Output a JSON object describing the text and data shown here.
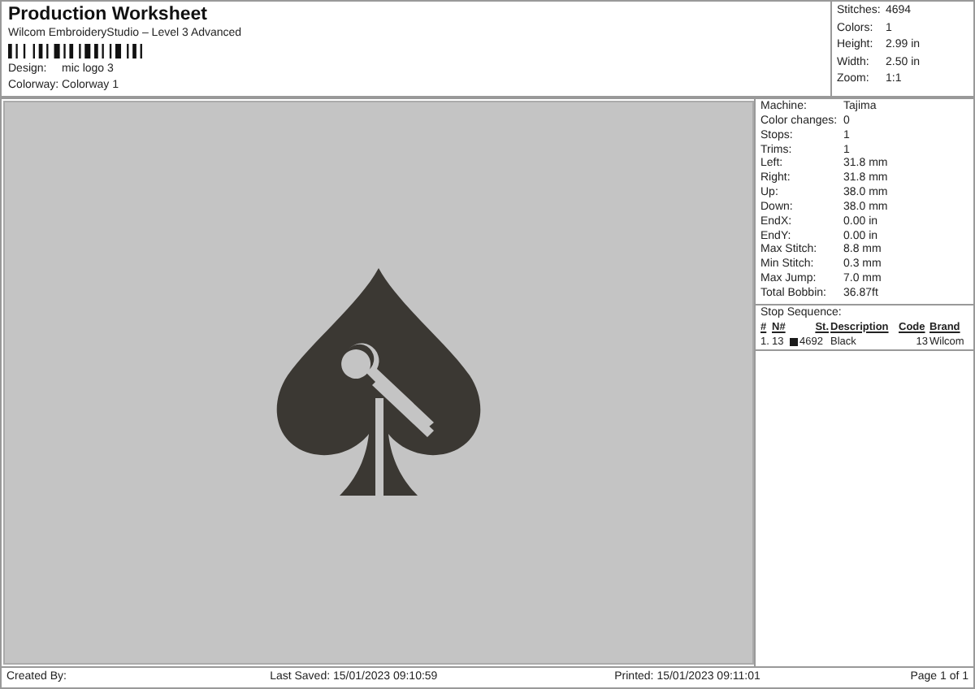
{
  "header": {
    "title": "Production Worksheet",
    "subtitle": "Wilcom EmbroideryStudio – Level 3 Advanced",
    "fields": [
      {
        "label": "Design:",
        "value": "mic logo 3"
      },
      {
        "label": "Colorway:",
        "value": "Colorway 1"
      }
    ]
  },
  "summary": [
    {
      "label": "Stitches:",
      "value": "4694"
    },
    {
      "label": "Colors:",
      "value": "1"
    },
    {
      "label": "Height:",
      "value": "2.99 in"
    },
    {
      "label": "Width:",
      "value": "2.50 in"
    },
    {
      "label": "Zoom:",
      "value": "1:1"
    }
  ],
  "details": [
    {
      "label": "Machine:",
      "value": "Tajima"
    },
    {
      "label": "Color changes:",
      "value": "0"
    },
    {
      "label": "Stops:",
      "value": "1"
    },
    {
      "label": "Trims:",
      "value": "1"
    },
    {
      "label": "Left:",
      "value": "31.8 mm"
    },
    {
      "label": "Right:",
      "value": "31.8 mm"
    },
    {
      "label": "Up:",
      "value": "38.0 mm"
    },
    {
      "label": "Down:",
      "value": "38.0 mm"
    },
    {
      "label": "EndX:",
      "value": "0.00 in"
    },
    {
      "label": "EndY:",
      "value": "0.00 in"
    },
    {
      "label": "Max Stitch:",
      "value": "8.8 mm"
    },
    {
      "label": "Min Stitch:",
      "value": "0.3 mm"
    },
    {
      "label": "Max Jump:",
      "value": "7.0 mm"
    },
    {
      "label": "Total Bobbin:",
      "value": "36.87ft"
    }
  ],
  "stop_sequence": {
    "title": "Stop Sequence:",
    "columns": [
      "#",
      "N#",
      "St.",
      "Description",
      "Code",
      "Brand"
    ],
    "rows": [
      {
        "index": "1.",
        "needle": "13",
        "color": "#1a1a1a",
        "stitches": "4692",
        "description": "Black",
        "code": "13",
        "brand": "Wilcom"
      }
    ]
  },
  "footer": {
    "created_by": "Created By:",
    "last_saved": "Last Saved: 15/01/2023 09:10:59",
    "printed": "Printed: 15/01/2023 09:11:01",
    "page": "Page 1 of 1"
  }
}
